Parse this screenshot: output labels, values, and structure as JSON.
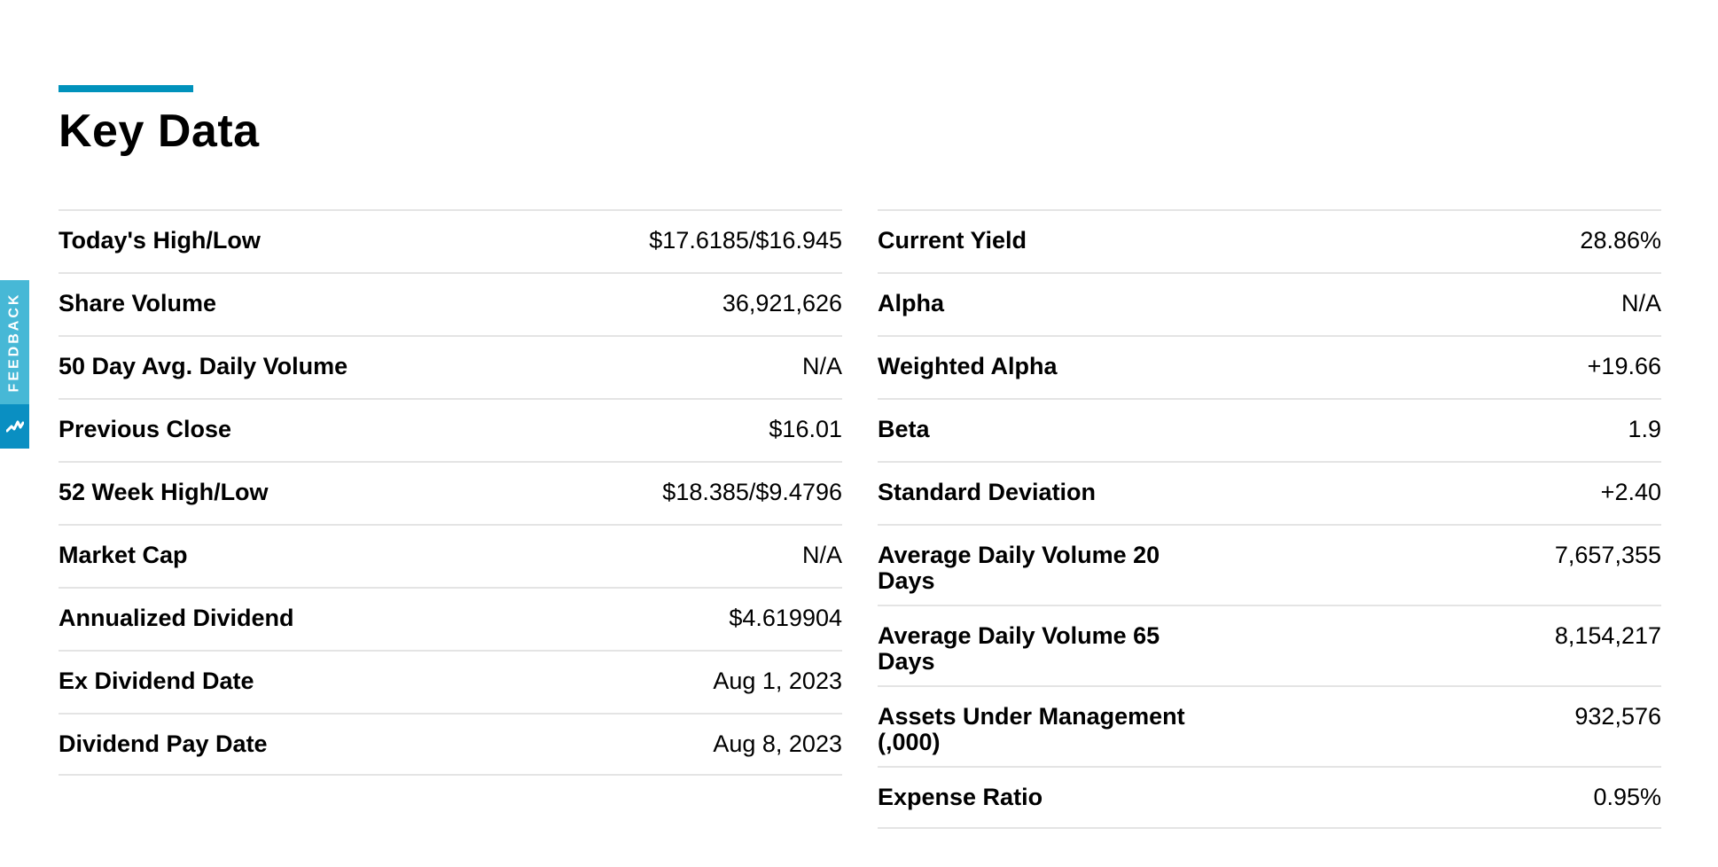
{
  "header": {
    "title": "Key Data"
  },
  "feedback": {
    "label": "FEEDBACK",
    "icon": "feedback-logo-icon"
  },
  "colors": {
    "accent": "#0092bc",
    "feedback_tab": "#47b8d6",
    "feedback_icon_bg": "#0a8fc2",
    "divider": "#e4e4e4"
  },
  "key_data": {
    "left": [
      {
        "label": "Today's High/Low",
        "value": "$17.6185/$16.945"
      },
      {
        "label": "Share Volume",
        "value": "36,921,626"
      },
      {
        "label": "50 Day Avg. Daily Volume",
        "value": "N/A"
      },
      {
        "label": "Previous Close",
        "value": "$16.01"
      },
      {
        "label": "52 Week High/Low",
        "value": "$18.385/$9.4796"
      },
      {
        "label": "Market Cap",
        "value": "N/A"
      },
      {
        "label": "Annualized Dividend",
        "value": "$4.619904"
      },
      {
        "label": "Ex Dividend Date",
        "value": "Aug 1, 2023"
      },
      {
        "label": "Dividend Pay Date",
        "value": "Aug 8, 2023"
      }
    ],
    "right": [
      {
        "label": "Current Yield",
        "value": "28.86%"
      },
      {
        "label": "Alpha",
        "value": "N/A"
      },
      {
        "label": "Weighted Alpha",
        "value": "+19.66"
      },
      {
        "label": "Beta",
        "value": "1.9"
      },
      {
        "label": "Standard Deviation",
        "value": "+2.40"
      },
      {
        "label": "Average Daily Volume 20 Days",
        "value": "7,657,355"
      },
      {
        "label": "Average Daily Volume 65 Days",
        "value": "8,154,217"
      },
      {
        "label": "Assets Under Management (,000)",
        "value": "932,576"
      },
      {
        "label": "Expense Ratio",
        "value": "0.95%"
      }
    ]
  }
}
